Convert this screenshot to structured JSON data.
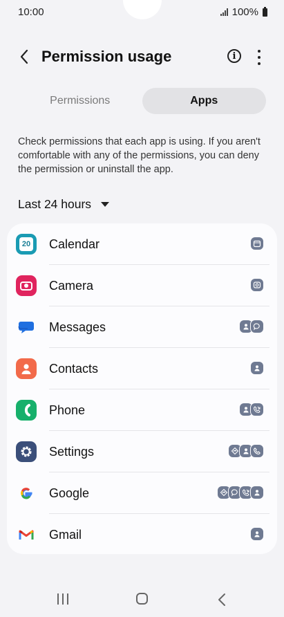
{
  "status": {
    "time": "10:00",
    "battery": "100%"
  },
  "appbar": {
    "title": "Permission usage"
  },
  "tabs": [
    {
      "label": "Permissions",
      "active": false
    },
    {
      "label": "Apps",
      "active": true
    }
  ],
  "description": "Check permissions that each app is using. If you aren't comfortable with any of the permissions, you can deny the permission or uninstall the app.",
  "filter": {
    "label": "Last 24 hours"
  },
  "apps": [
    {
      "name": "Calendar",
      "icon": "calendar-icon",
      "permissions": [
        "calendar-permission-icon"
      ]
    },
    {
      "name": "Camera",
      "icon": "camera-icon",
      "permissions": [
        "camera-permission-icon"
      ]
    },
    {
      "name": "Messages",
      "icon": "messages-icon",
      "permissions": [
        "contacts-permission-icon",
        "sms-permission-icon"
      ]
    },
    {
      "name": "Contacts",
      "icon": "contacts-icon",
      "permissions": [
        "contacts-permission-icon"
      ]
    },
    {
      "name": "Phone",
      "icon": "phone-icon",
      "permissions": [
        "contacts-permission-icon",
        "call-log-permission-icon"
      ]
    },
    {
      "name": "Settings",
      "icon": "settings-icon",
      "permissions": [
        "location-permission-icon",
        "contacts-permission-icon",
        "phone-permission-icon"
      ]
    },
    {
      "name": "Google",
      "icon": "google-icon",
      "permissions": [
        "location-permission-icon",
        "sms-permission-icon",
        "call-log-permission-icon",
        "contacts-permission-icon"
      ]
    },
    {
      "name": "Gmail",
      "icon": "gmail-icon",
      "permissions": [
        "contacts-permission-icon"
      ]
    }
  ],
  "colors": {
    "background": "#f3f3f6",
    "card": "#fcfcfe",
    "permission_badge": "#6f7a92",
    "active_tab": "#e2e2e5"
  }
}
